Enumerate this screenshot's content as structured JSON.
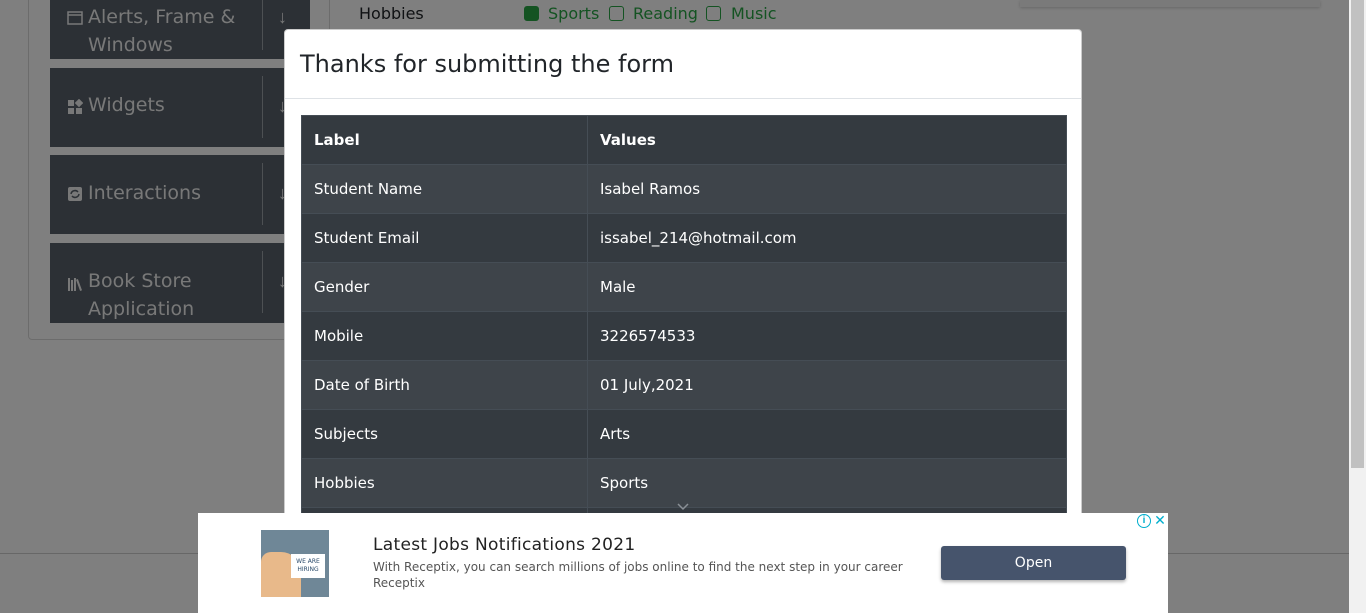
{
  "background": {
    "sidebar": {
      "groups": [
        {
          "label": "Alerts, Frame & Windows",
          "icon": "window-icon"
        },
        {
          "label": "Widgets",
          "icon": "widgets-icon"
        },
        {
          "label": "Interactions",
          "icon": "interactions-icon"
        },
        {
          "label": "Book Store Application",
          "icon": "books-icon"
        }
      ]
    },
    "form": {
      "hobbies_label": "Hobbies",
      "hobbies": [
        {
          "label": "Sports",
          "checked": true
        },
        {
          "label": "Reading",
          "checked": false
        },
        {
          "label": "Music",
          "checked": false
        }
      ]
    }
  },
  "modal": {
    "title": "Thanks for submitting the form",
    "table": {
      "headers": [
        "Label",
        "Values"
      ],
      "rows": [
        [
          "Student Name",
          "Isabel Ramos"
        ],
        [
          "Student Email",
          "issabel_214@hotmail.com"
        ],
        [
          "Gender",
          "Male"
        ],
        [
          "Mobile",
          "3226574533"
        ],
        [
          "Date of Birth",
          "01 July,2021"
        ],
        [
          "Subjects",
          "Arts"
        ],
        [
          "Hobbies",
          "Sports"
        ]
      ]
    }
  },
  "ad": {
    "image_text": "WE ARE HIRING",
    "title": "Latest Jobs Notifications 2021",
    "description": "With Receptix, you can search millions of jobs online to find the next step in your career",
    "source": "Receptix",
    "button_label": "Open",
    "info_icon": "info-icon",
    "close_icon": "close-icon"
  }
}
